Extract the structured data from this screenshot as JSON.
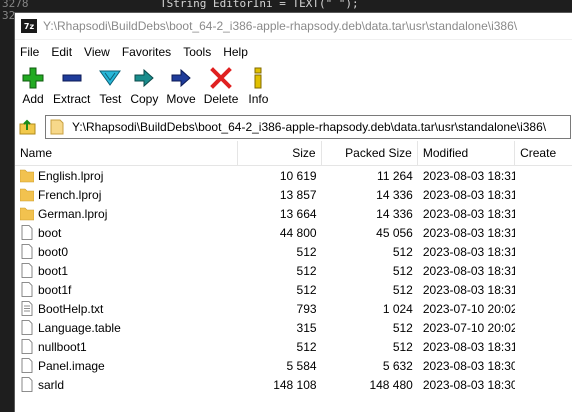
{
  "background_code": {
    "line1": "3278",
    "line2": "32",
    "fragment": "TString EditorIni = TEXT(\"  \");"
  },
  "window": {
    "app_icon_text": "7z",
    "title": "Y:\\Rhapsodi\\BuildDebs\\boot_64-2_i386-apple-rhapsody.deb\\data.tar\\usr\\standalone\\i386\\"
  },
  "menu": [
    "File",
    "Edit",
    "View",
    "Favorites",
    "Tools",
    "Help"
  ],
  "toolbar": [
    {
      "label": "Add",
      "icon": "add-icon",
      "color": "#22aa22"
    },
    {
      "label": "Extract",
      "icon": "extract-icon",
      "color": "#1f3c9a"
    },
    {
      "label": "Test",
      "icon": "test-icon",
      "color": "#27b7d8"
    },
    {
      "label": "Copy",
      "icon": "copy-icon",
      "color": "#1a8c8c"
    },
    {
      "label": "Move",
      "icon": "move-icon",
      "color": "#1f3c9a"
    },
    {
      "label": "Delete",
      "icon": "delete-icon",
      "color": "#e02020"
    },
    {
      "label": "Info",
      "icon": "info-icon",
      "color": "#e0c000"
    }
  ],
  "address": {
    "path": "Y:\\Rhapsodi\\BuildDebs\\boot_64-2_i386-apple-rhapsody.deb\\data.tar\\usr\\standalone\\i386\\"
  },
  "columns": {
    "name": "Name",
    "size": "Size",
    "packed": "Packed Size",
    "modified": "Modified",
    "created": "Create"
  },
  "files": [
    {
      "name": "English.lproj",
      "type": "folder",
      "size": "10 619",
      "packed": "11 264",
      "modified": "2023-08-03 18:31"
    },
    {
      "name": "French.lproj",
      "type": "folder",
      "size": "13 857",
      "packed": "14 336",
      "modified": "2023-08-03 18:31"
    },
    {
      "name": "German.lproj",
      "type": "folder",
      "size": "13 664",
      "packed": "14 336",
      "modified": "2023-08-03 18:31"
    },
    {
      "name": "boot",
      "type": "file",
      "size": "44 800",
      "packed": "45 056",
      "modified": "2023-08-03 18:31"
    },
    {
      "name": "boot0",
      "type": "file",
      "size": "512",
      "packed": "512",
      "modified": "2023-08-03 18:31"
    },
    {
      "name": "boot1",
      "type": "file",
      "size": "512",
      "packed": "512",
      "modified": "2023-08-03 18:31"
    },
    {
      "name": "boot1f",
      "type": "file",
      "size": "512",
      "packed": "512",
      "modified": "2023-08-03 18:31"
    },
    {
      "name": "BootHelp.txt",
      "type": "text",
      "size": "793",
      "packed": "1 024",
      "modified": "2023-07-10 20:02"
    },
    {
      "name": "Language.table",
      "type": "file",
      "size": "315",
      "packed": "512",
      "modified": "2023-07-10 20:02"
    },
    {
      "name": "nullboot1",
      "type": "file",
      "size": "512",
      "packed": "512",
      "modified": "2023-08-03 18:31"
    },
    {
      "name": "Panel.image",
      "type": "file",
      "size": "5 584",
      "packed": "5 632",
      "modified": "2023-08-03 18:30"
    },
    {
      "name": "sarld",
      "type": "file",
      "size": "148 108",
      "packed": "148 480",
      "modified": "2023-08-03 18:30"
    }
  ]
}
